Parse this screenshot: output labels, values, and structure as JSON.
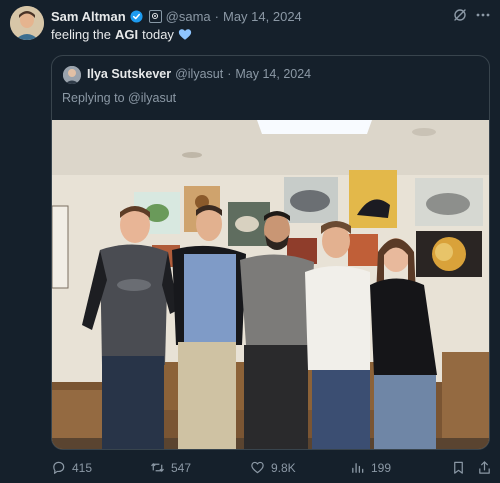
{
  "tweet": {
    "author_name": "Sam Altman",
    "author_handle": "@sama",
    "separator": "·",
    "date": "May 14, 2024",
    "text_before": "feeling the",
    "text_bold": "AGI",
    "text_after": "today"
  },
  "quote": {
    "author_name": "Ilya Sutskever",
    "author_handle": "@ilyasut",
    "separator": "·",
    "date": "May 14, 2024",
    "reply_label": "Replying to @ilyasut"
  },
  "actions": {
    "replies": "415",
    "reposts": "547",
    "likes": "9.8K",
    "views": "199"
  },
  "colors": {
    "background": "#15202b",
    "secondary_text": "#8b98a5",
    "verified_blue": "#1d9bf0",
    "heart_blue": "#8ec5ff"
  },
  "icons": {
    "verified": "verified-badge-icon",
    "org": "org-badge-icon",
    "grok": "grok-icon",
    "more": "more-icon",
    "reply": "reply-icon",
    "repost": "repost-icon",
    "like": "like-icon",
    "views": "views-icon",
    "bookmark": "bookmark-icon",
    "share": "share-icon"
  }
}
